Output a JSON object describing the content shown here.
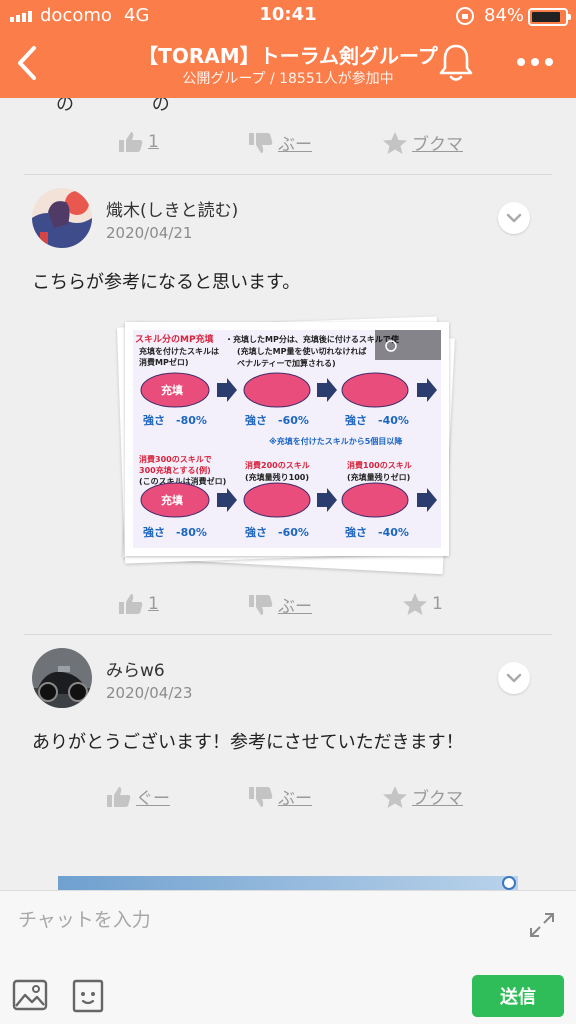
{
  "status_bar": {
    "carrier": "docomo",
    "network": "4G",
    "time": "10:41",
    "battery": "84%"
  },
  "header": {
    "title": "【TORAM】トーラム剣グループ",
    "subtitle": "公開グループ / 18551人が参加中",
    "bg_color": "#fb7d4a"
  },
  "prev_post": {
    "clipped_text": "の　　　　 の　　　　",
    "likes": "1",
    "boo": "ぶー",
    "bookmark": "ブクマ"
  },
  "post1": {
    "author": "熾木(しきと読む)",
    "date": "2020/04/21",
    "text": "こちらが参考になると思います。",
    "likes": "1",
    "boo": "ぶー",
    "bookmarks": "1",
    "image": {
      "headline_left": "スキル分のMP充填",
      "line_left_2": "充填を付けたスキルは",
      "line_left_3": "消費MPゼロ)",
      "headline_right": "・充填したMP分は、充填後に付けるスキルで使",
      "line_right_2": "(充填したMP量を使い切れなければ",
      "line_right_3": "ペナルティーで加算される)",
      "oval_label": "充填",
      "power_1": "強さ　-80%",
      "power_2": "強さ　-60%",
      "power_3": "強さ　-40%",
      "note": "※充填を付けたスキルから5個目以降",
      "row2_left_1": "消費300のスキルで",
      "row2_left_2": "300充填とする(例)",
      "row2_left_3": "(このスキルは消費ゼロ)",
      "row2_mid_1": "消費200のスキル",
      "row2_mid_2": "(充填量残り100)",
      "row2_right_1": "消費100のスキル",
      "row2_right_2": "(充填量残りゼロ)",
      "oval_color": "#e84d7b",
      "bg_color": "#f3f0fb"
    }
  },
  "post2": {
    "author": "みらw6",
    "date": "2020/04/23",
    "text": "ありがとうございます！参考にさせていただきます！",
    "good": "ぐー",
    "boo": "ぶー",
    "bookmark": "ブクマ"
  },
  "chat": {
    "placeholder": "チャットを入力",
    "send_label": "送信",
    "send_color": "#2fbd59"
  }
}
